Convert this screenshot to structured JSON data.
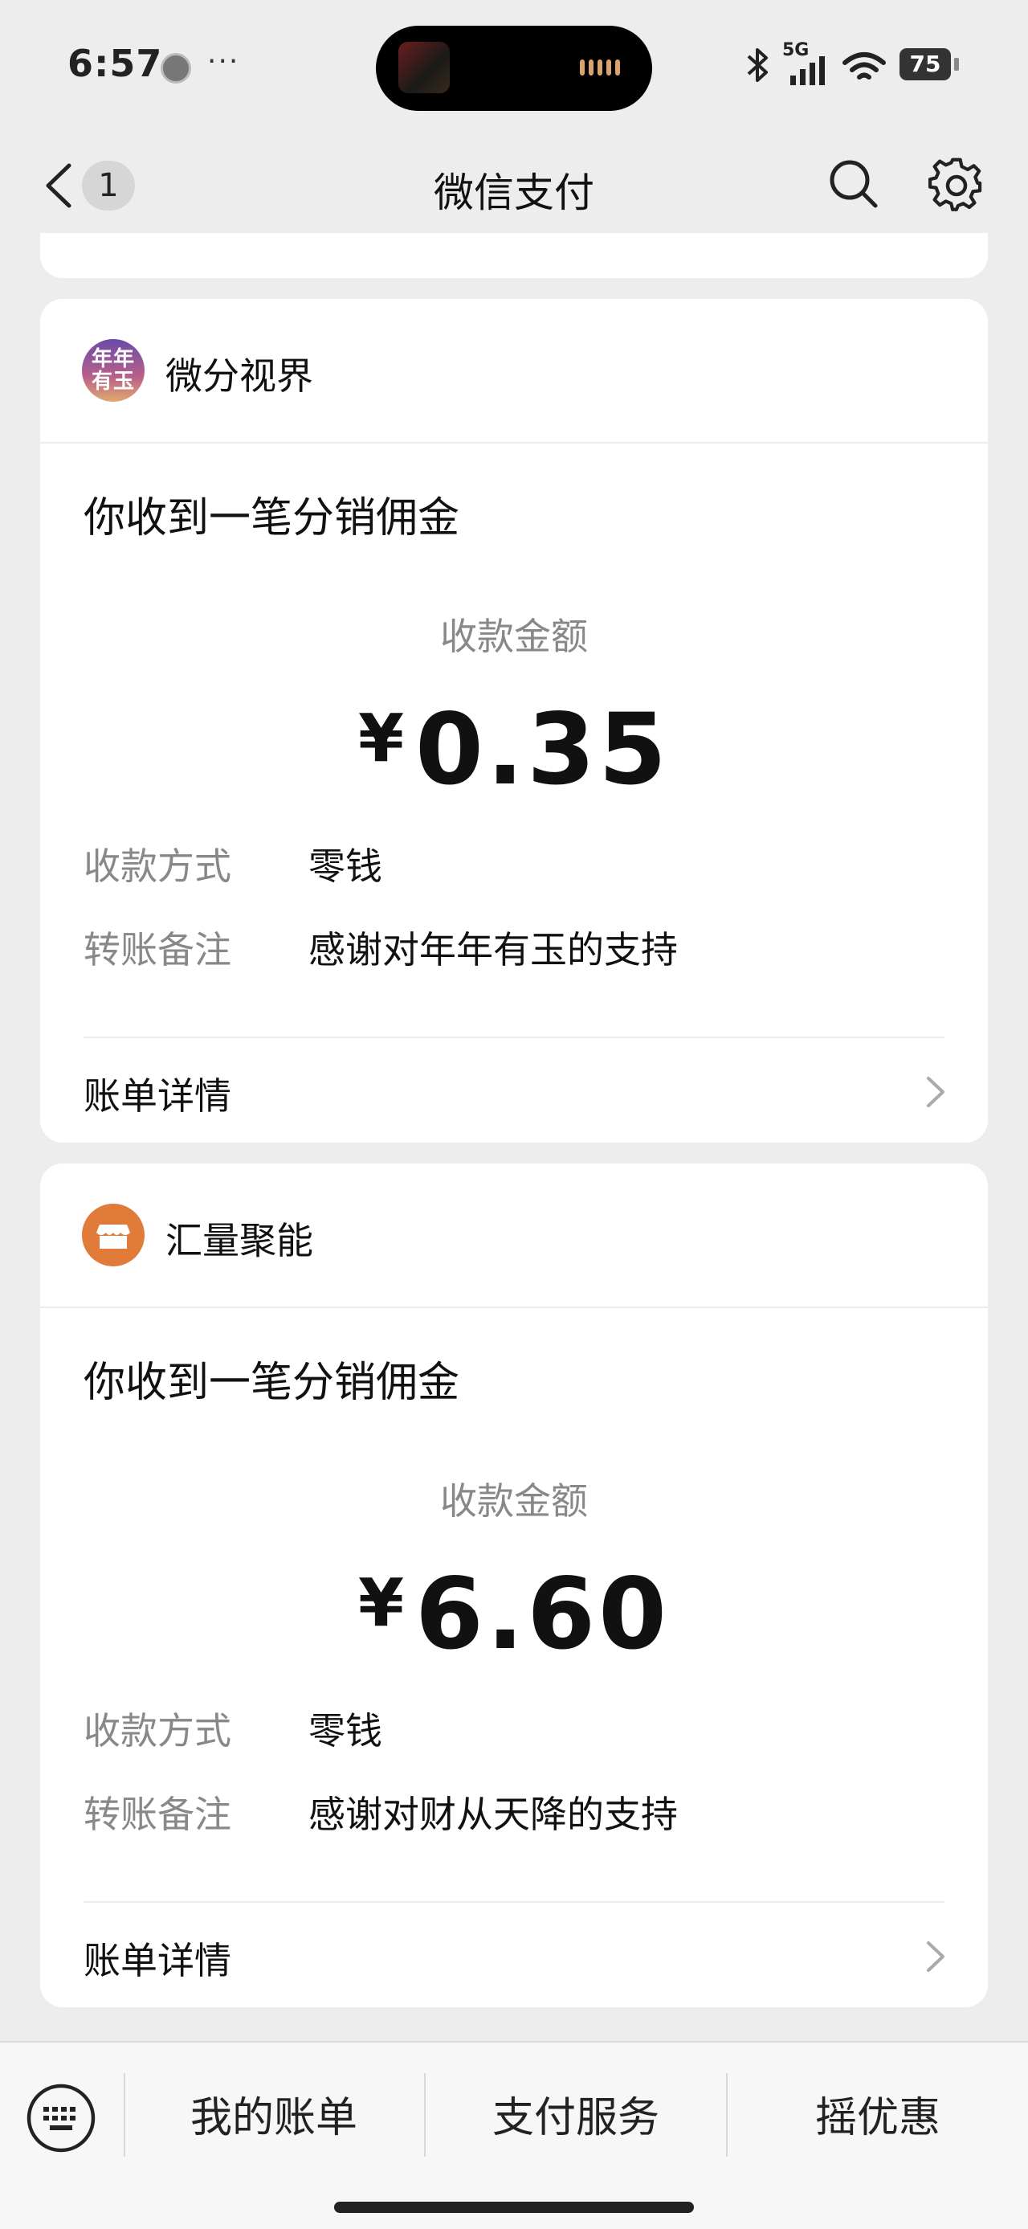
{
  "status_bar": {
    "time": "6:57",
    "extra_dots": "···",
    "network": "5G",
    "battery": "75"
  },
  "nav": {
    "back_badge": "1",
    "title": "微信支付"
  },
  "cards": [
    {
      "merchant": "微分视界",
      "avatar_text": "年年\n有玉",
      "message_title": "你收到一笔分销佣金",
      "amount_label": "收款金额",
      "currency": "¥",
      "amount": "0.35",
      "method_key": "收款方式",
      "method_value": "零钱",
      "remark_key": "转账备注",
      "remark_value": "感谢对年年有玉的支持",
      "detail_label": "账单详情"
    },
    {
      "merchant": "汇量聚能",
      "message_title": "你收到一笔分销佣金",
      "amount_label": "收款金额",
      "currency": "¥",
      "amount": "6.60",
      "method_key": "收款方式",
      "method_value": "零钱",
      "remark_key": "转账备注",
      "remark_value": "感谢对财从天降的支持",
      "detail_label": "账单详情"
    }
  ],
  "bottom_tabs": [
    "我的账单",
    "支付服务",
    "摇优惠"
  ],
  "icons": {
    "back": "chevron-left-icon",
    "search": "search-icon",
    "settings": "gear-icon",
    "keyboard": "keyboard-icon",
    "shop": "shop-icon"
  },
  "colors": {
    "background": "#ededed",
    "card": "#ffffff",
    "muted_text": "#888888",
    "shop_icon": "#e07b3a"
  }
}
